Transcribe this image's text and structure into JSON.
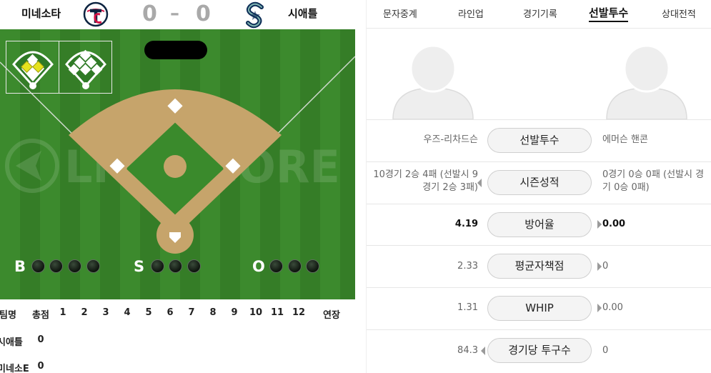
{
  "scoreboard": {
    "away_team": "미네소타",
    "home_team": "시애틀",
    "away_score": "0",
    "separator": "–",
    "home_score": "0",
    "away_logo_icon": "twins-tc-logo-icon",
    "home_logo_icon": "mariners-s-logo-icon"
  },
  "field": {
    "watermark": "LIVESCORE",
    "count_labels": {
      "balls": "B",
      "strikes": "S",
      "outs": "O"
    },
    "balls": 0,
    "strikes": 0,
    "outs": 0,
    "colors": {
      "grass": "#3c8a2d",
      "infield": "#c6a46b",
      "base": "#ffffff",
      "runner": "#e6e21e"
    }
  },
  "linescore": {
    "headers": [
      "팀명",
      "총점",
      "1",
      "2",
      "3",
      "4",
      "5",
      "6",
      "7",
      "8",
      "9",
      "10",
      "11",
      "12",
      "연장"
    ],
    "rows": [
      {
        "team": "시애틀",
        "total": "0"
      },
      {
        "team": "미네소E",
        "total": "0"
      }
    ]
  },
  "tabs": [
    {
      "label": "문자중계",
      "active": false
    },
    {
      "label": "라인업",
      "active": false
    },
    {
      "label": "경기기록",
      "active": false
    },
    {
      "label": "선발투수",
      "active": true
    },
    {
      "label": "상대전적",
      "active": false
    }
  ],
  "pitchers": {
    "stats": [
      {
        "label": "선발투수",
        "left": "우즈-리차드슨",
        "right": "에머슨 핸콘",
        "bold": false,
        "arrow": "none"
      },
      {
        "label": "시즌성적",
        "left": "10경기 2승 4패 (선발시 9경기 2승 3패)",
        "right": "0경기 0승 0패 (선발시 경기 0승 0패)",
        "bold": false,
        "arrow": "left"
      },
      {
        "label": "방어율",
        "left": "4.19",
        "right": "0.00",
        "bold": true,
        "arrow": "right"
      },
      {
        "label": "평균자책점",
        "left": "2.33",
        "right": "0",
        "bold": false,
        "arrow": "right"
      },
      {
        "label": "WHIP",
        "left": "1.31",
        "right": "0.00",
        "bold": false,
        "arrow": "right"
      },
      {
        "label": "경기당 투구수",
        "left": "84.3",
        "right": "0",
        "bold": false,
        "arrow": "left"
      }
    ]
  }
}
